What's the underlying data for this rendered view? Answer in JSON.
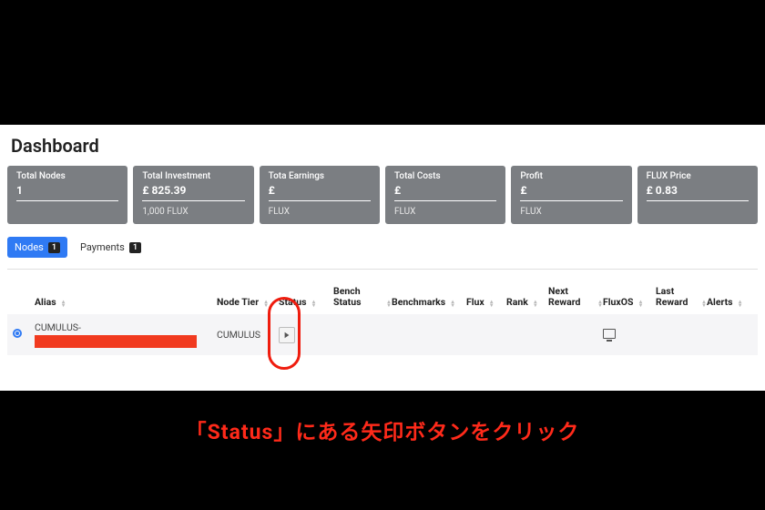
{
  "page_title": "Dashboard",
  "cards": [
    {
      "label": "Total Nodes",
      "value": "1",
      "sub": ""
    },
    {
      "label": "Total Investment",
      "value": "£ 825.39",
      "sub": "1,000 FLUX"
    },
    {
      "label": "Tota Earnings",
      "value": "£",
      "sub": "FLUX"
    },
    {
      "label": "Total Costs",
      "value": "£",
      "sub": "FLUX"
    },
    {
      "label": "Profit",
      "value": "£",
      "sub": "FLUX"
    },
    {
      "label": "FLUX Price",
      "value": "£ 0.83",
      "sub": ""
    }
  ],
  "tabs": {
    "nodes": {
      "label": "Nodes",
      "badge": "1"
    },
    "payments": {
      "label": "Payments",
      "badge": "1"
    }
  },
  "columns": {
    "alias": "Alias",
    "tier": "Node Tier",
    "status": "Status",
    "bench": "Bench Status",
    "benchmarks": "Benchmarks",
    "flux": "Flux",
    "rank": "Rank",
    "next": "Next Reward",
    "fluxos": "FluxOS",
    "last": "Last Reward",
    "alerts": "Alerts"
  },
  "row": {
    "alias": "CUMULUS-",
    "tier": "CUMULUS"
  },
  "caption": "「Status」にある矢印ボタンをクリック"
}
